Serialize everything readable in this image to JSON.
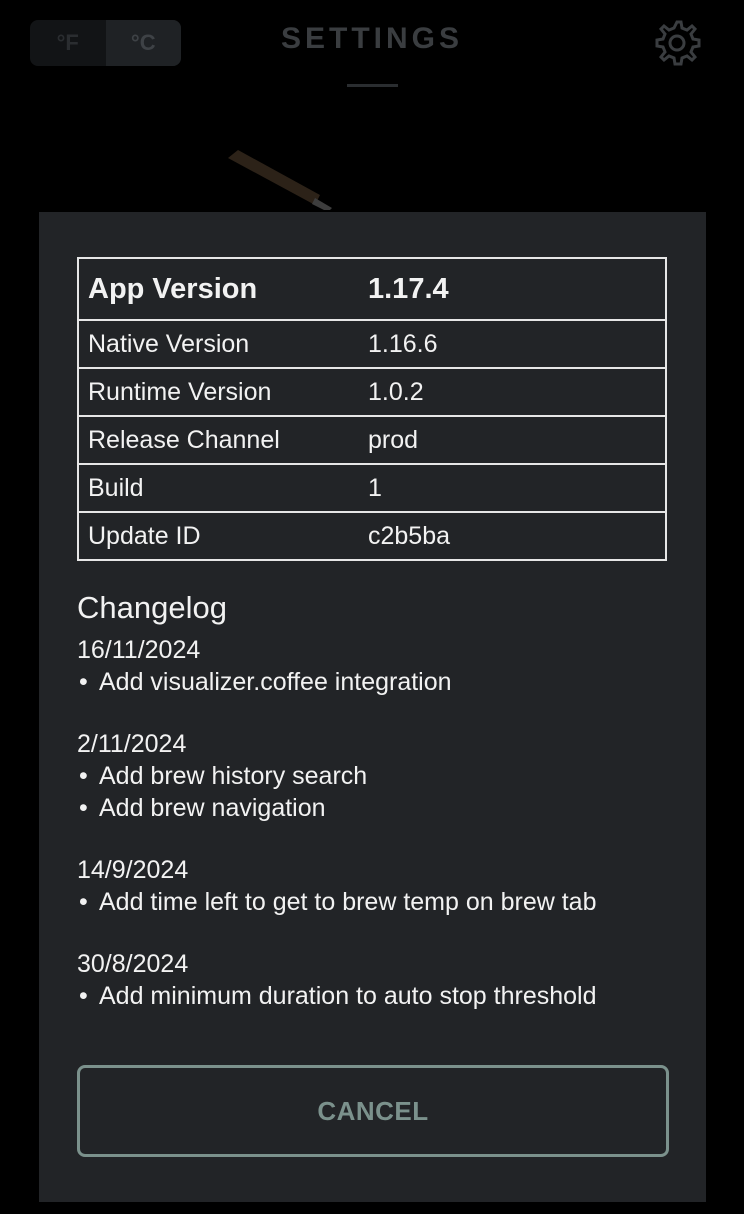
{
  "header": {
    "title": "SETTINGS",
    "units": [
      {
        "label": "°F",
        "active": false
      },
      {
        "label": "°C",
        "active": true
      }
    ],
    "settings_icon": "gear-icon"
  },
  "modal": {
    "info_rows": [
      {
        "key": "App Version",
        "value": "1.17.4"
      },
      {
        "key": "Native Version",
        "value": "1.16.6"
      },
      {
        "key": "Runtime Version",
        "value": "1.0.2"
      },
      {
        "key": "Release Channel",
        "value": "prod"
      },
      {
        "key": "Build",
        "value": "1"
      },
      {
        "key": "Update ID",
        "value": "c2b5ba"
      }
    ],
    "changelog_title": "Changelog",
    "changelog": [
      {
        "date": "16/11/2024",
        "items": [
          "Add visualizer.coffee integration"
        ]
      },
      {
        "date": "2/11/2024",
        "items": [
          "Add brew history search",
          "Add brew navigation"
        ]
      },
      {
        "date": "14/9/2024",
        "items": [
          "Add time left to get to brew temp on brew tab"
        ]
      },
      {
        "date": "30/8/2024",
        "items": [
          "Add minimum duration to auto stop threshold"
        ]
      }
    ],
    "bullet": "•",
    "cancel_label": "CANCEL"
  },
  "colors": {
    "overlay_bg": "#222427",
    "accent": "#7b918c",
    "table_border": "#e6e6e6"
  }
}
